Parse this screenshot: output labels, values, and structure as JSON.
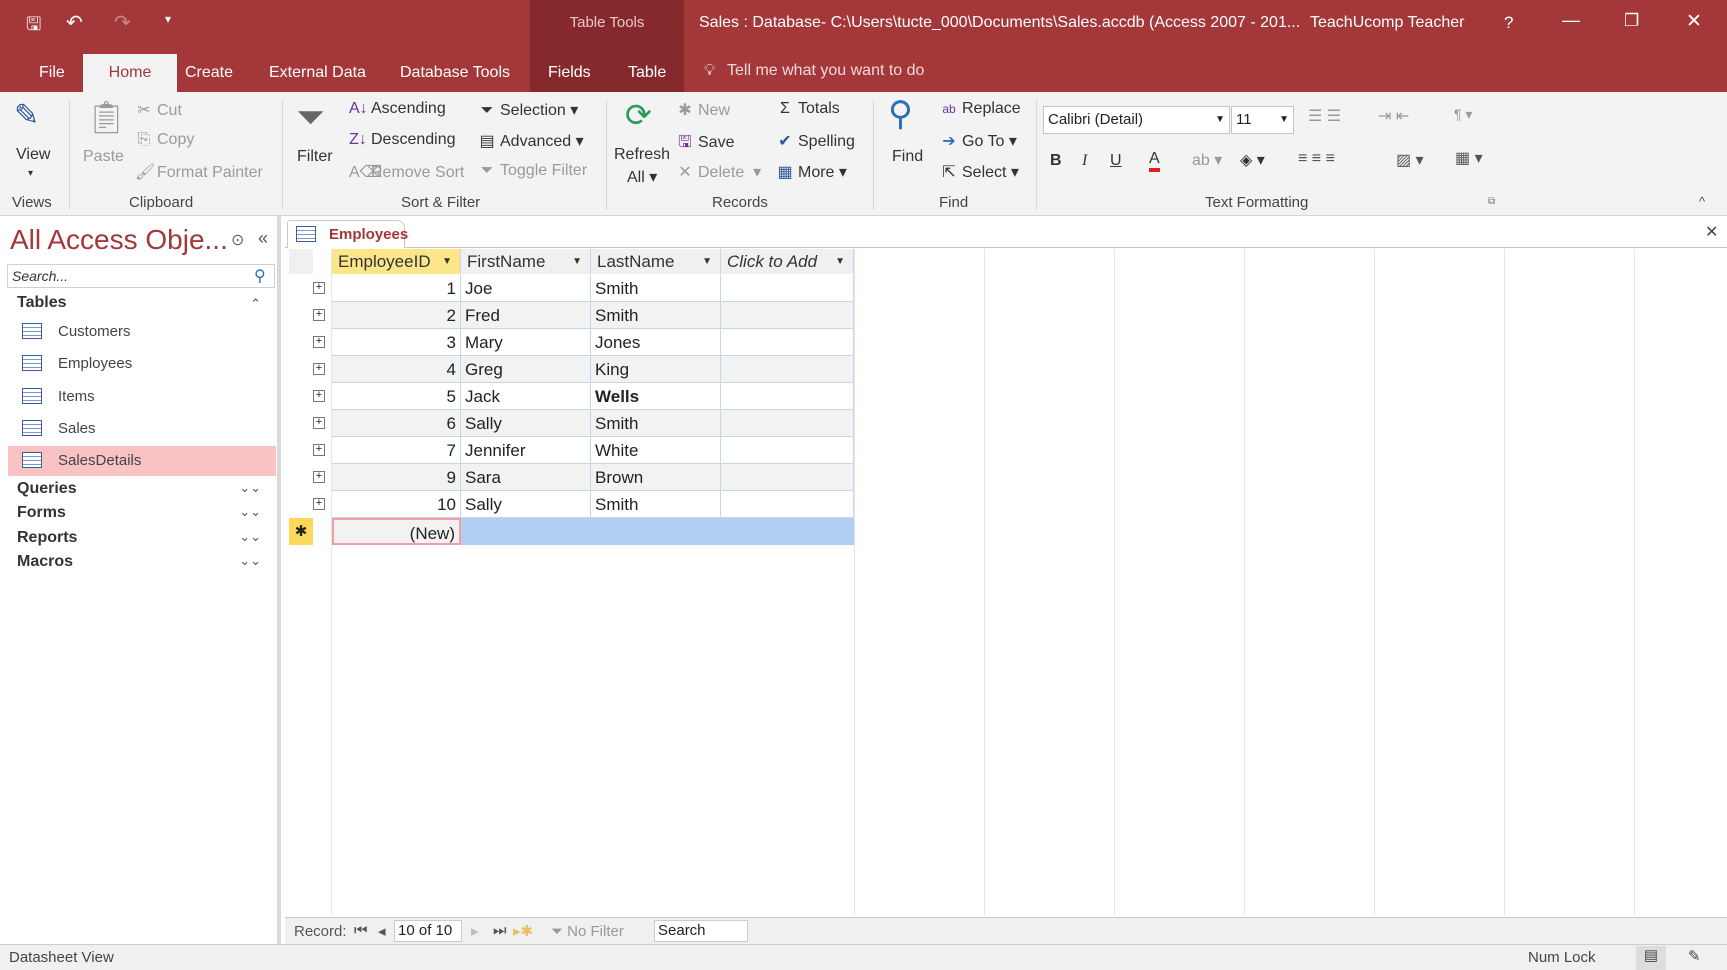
{
  "titlebar": {
    "context_tools": "Table Tools",
    "title": "Sales : Database- C:\\Users\\tucte_000\\Documents\\Sales.accdb (Access 2007 - 201...",
    "user": "TeachUcomp Teacher",
    "help": "?"
  },
  "tabs": [
    "File",
    "Home",
    "Create",
    "External Data",
    "Database Tools",
    "Fields",
    "Table"
  ],
  "tell_me": "Tell me what you want to do",
  "ribbon": {
    "views": {
      "view": "View",
      "group": "Views"
    },
    "clipboard": {
      "paste": "Paste",
      "cut": "Cut",
      "copy": "Copy",
      "format_painter": "Format Painter",
      "group": "Clipboard"
    },
    "sort_filter": {
      "filter": "Filter",
      "ascending": "Ascending",
      "descending": "Descending",
      "remove_sort": "Remove Sort",
      "selection": "Selection",
      "advanced": "Advanced",
      "toggle_filter": "Toggle Filter",
      "group": "Sort & Filter"
    },
    "records": {
      "refresh": "Refresh",
      "refresh2": "All",
      "new": "New",
      "save": "Save",
      "delete": "Delete",
      "totals": "Totals",
      "spelling": "Spelling",
      "more": "More",
      "group": "Records"
    },
    "find": {
      "find": "Find",
      "replace": "Replace",
      "goto": "Go To",
      "select": "Select",
      "group": "Find"
    },
    "text_formatting": {
      "font": "Calibri (Detail)",
      "size": "11",
      "bold": "B",
      "italic": "I",
      "underline": "U",
      "group": "Text Formatting",
      "font_color": "#e02020"
    }
  },
  "nav": {
    "title": "All Access Obje...",
    "search_placeholder": "Search...",
    "tables_header": "Tables",
    "tables": [
      "Customers",
      "Employees",
      "Items",
      "Sales",
      "SalesDetails"
    ],
    "selected": "SalesDetails",
    "sections": [
      "Queries",
      "Forms",
      "Reports",
      "Macros"
    ]
  },
  "document": {
    "tab": "Employees",
    "columns": [
      "EmployeeID",
      "FirstName",
      "LastName",
      "Click to Add"
    ],
    "rows": [
      [
        "1",
        "Joe",
        "Smith"
      ],
      [
        "2",
        "Fred",
        "Smith"
      ],
      [
        "3",
        "Mary",
        "Jones"
      ],
      [
        "4",
        "Greg",
        "King"
      ],
      [
        "5",
        "Jack",
        "Wells"
      ],
      [
        "6",
        "Sally",
        "Smith"
      ],
      [
        "7",
        "Jennifer",
        "White"
      ],
      [
        "9",
        "Sara",
        "Brown"
      ],
      [
        "10",
        "Sally",
        "Smith"
      ]
    ],
    "new_row": "(New)"
  },
  "record_nav": {
    "label": "Record:",
    "position": "10 of 10",
    "filter": "No Filter",
    "search": "Search"
  },
  "status": {
    "view": "Datasheet View",
    "numlock": "Num Lock"
  }
}
